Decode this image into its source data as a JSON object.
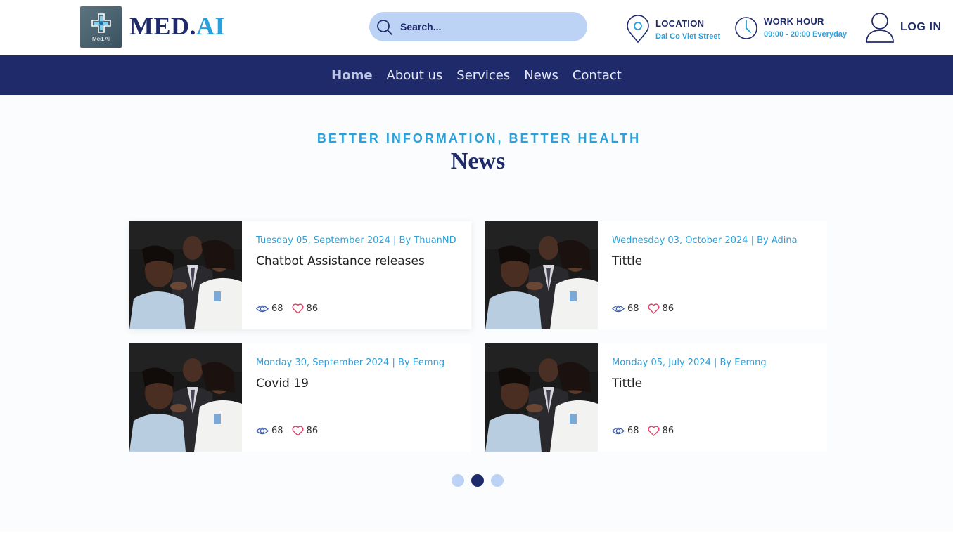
{
  "header": {
    "logo_sub": "Med.Ai",
    "brand_part1": "MED.",
    "brand_part2": "AI",
    "search_placeholder": "Search...",
    "location_label": "LOCATION",
    "location_value": "Dai Co Viet Street",
    "work_label": "WORK HOUR",
    "work_value": "09:00 - 20:00 Everyday",
    "login_label": "LOG IN"
  },
  "nav": {
    "items": [
      {
        "label": "Home",
        "active": true
      },
      {
        "label": "About us"
      },
      {
        "label": "Services"
      },
      {
        "label": "News"
      },
      {
        "label": "Contact"
      }
    ]
  },
  "section": {
    "kicker": "BETTER INFORMATION, BETTER HEALTH",
    "title": "News"
  },
  "cards": [
    {
      "meta": "Tuesday 05, September 2024 | By  ThuanND",
      "title": "Chatbot Assistance releases",
      "views": "68",
      "likes": "86"
    },
    {
      "meta": "Wednesday 03, October 2024 | By Adina",
      "title": "Tittle",
      "views": "68",
      "likes": "86"
    },
    {
      "meta": "Monday 30, September 2024 | By Eemng",
      "title": "Covid 19",
      "views": "68",
      "likes": "86"
    },
    {
      "meta": "Monday 05, July 2024 | By Eemng",
      "title": "Tittle",
      "views": "68",
      "likes": "86"
    }
  ],
  "pagination": {
    "active_index": 1
  },
  "colors": {
    "navy": "#1f2a6b",
    "accent": "#2aa0dc",
    "search_bg": "#bcd3f5",
    "like": "#e0406a"
  }
}
